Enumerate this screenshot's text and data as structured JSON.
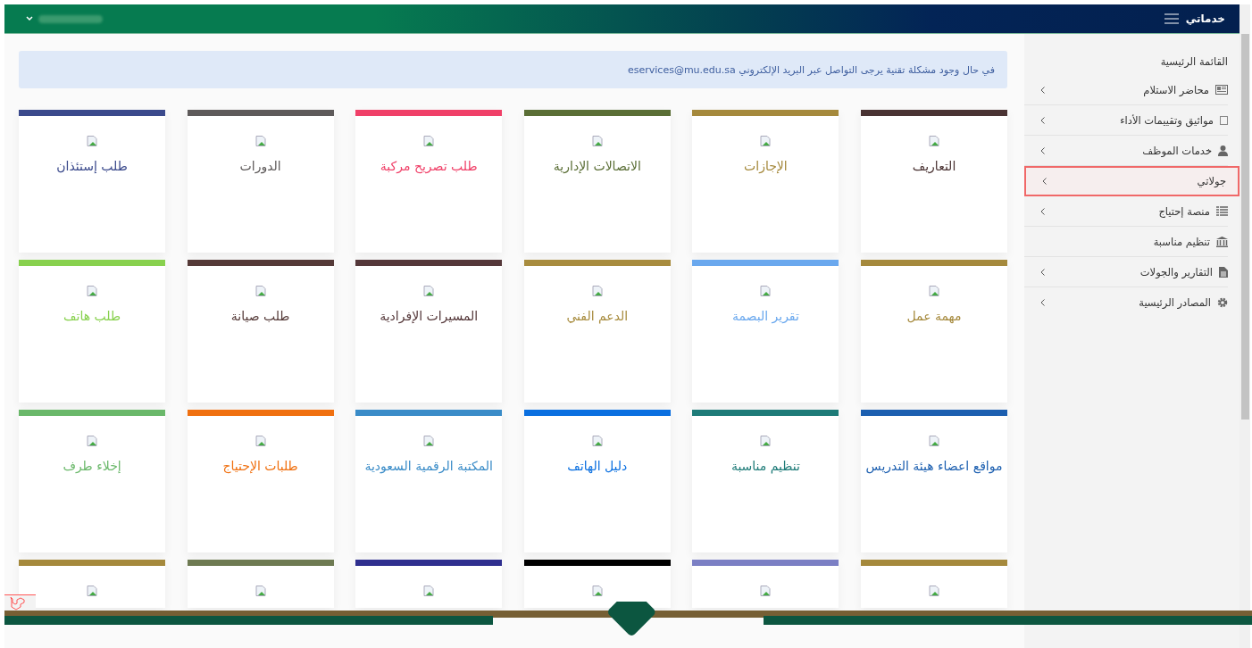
{
  "top_bar": {
    "title": "خدماتي"
  },
  "sidebar": {
    "heading": "القائمة الرئيسية",
    "items": [
      {
        "label": "محاضر الاستلام",
        "kind": "newspaper",
        "has_submenu": true,
        "highlighted": false
      },
      {
        "label": "مواثيق وتقييمات الأداء",
        "kind": "square",
        "has_submenu": true,
        "highlighted": false
      },
      {
        "label": "خدمات الموظف",
        "kind": "user",
        "has_submenu": true,
        "highlighted": false
      },
      {
        "label": "جولاتي",
        "kind": "none",
        "has_submenu": true,
        "highlighted": true
      },
      {
        "label": "منصة إحتياج",
        "kind": "list",
        "has_submenu": true,
        "highlighted": false
      },
      {
        "label": "تنظيم مناسبة",
        "kind": "bank",
        "has_submenu": false,
        "highlighted": false
      },
      {
        "label": "التقارير والجولات",
        "kind": "file",
        "has_submenu": true,
        "highlighted": false
      },
      {
        "label": "المصادر الرئيسية",
        "kind": "gear",
        "has_submenu": true,
        "highlighted": false
      }
    ]
  },
  "alert": {
    "text": "في حال وجود مشكلة تقنية يرجى التواصل عبر البريد الإلكتروني eservices@mu.edu.sa"
  },
  "cards": [
    {
      "title": "التعاريف",
      "color": "#4a3333"
    },
    {
      "title": "الإجازات",
      "color": "#a5893c"
    },
    {
      "title": "الاتصالات الإدارية",
      "color": "#5a6e35"
    },
    {
      "title": "طلب تصريح مركبة",
      "color": "#f04068"
    },
    {
      "title": "الدورات",
      "color": "#5e5a5a"
    },
    {
      "title": "طلب إستئذان",
      "color": "#3b4a8c"
    },
    {
      "title": "مهمة عمل",
      "color": "#a5893c"
    },
    {
      "title": "تقرير البصمة",
      "color": "#6aa8ee"
    },
    {
      "title": "الدعم الفني",
      "color": "#a88c3e"
    },
    {
      "title": "المسيرات الإفرادية",
      "color": "#55383a"
    },
    {
      "title": "طلب صيانة",
      "color": "#553a38"
    },
    {
      "title": "طلب هاتف",
      "color": "#88d14e"
    },
    {
      "title": "مواقع اعضاء هيئة التدريس",
      "color": "#1c5fb0"
    },
    {
      "title": "تنظيم مناسبة",
      "color": "#1e7b78"
    },
    {
      "title": "دليل الهاتف",
      "color": "#0a6fe0"
    },
    {
      "title": "المكتبة الرقمية السعودية",
      "color": "#3a8cc8"
    },
    {
      "title": "طلبات الإحتياج",
      "color": "#f07010"
    },
    {
      "title": "إخلاء طرف",
      "color": "#6ab86a"
    },
    {
      "color": "#a5893c"
    },
    {
      "color": "#7b7fc4"
    },
    {
      "color": "#000000"
    },
    {
      "color": "#2f2f8f"
    },
    {
      "color": "#6e7a52"
    },
    {
      "color": "#a5893c"
    }
  ]
}
